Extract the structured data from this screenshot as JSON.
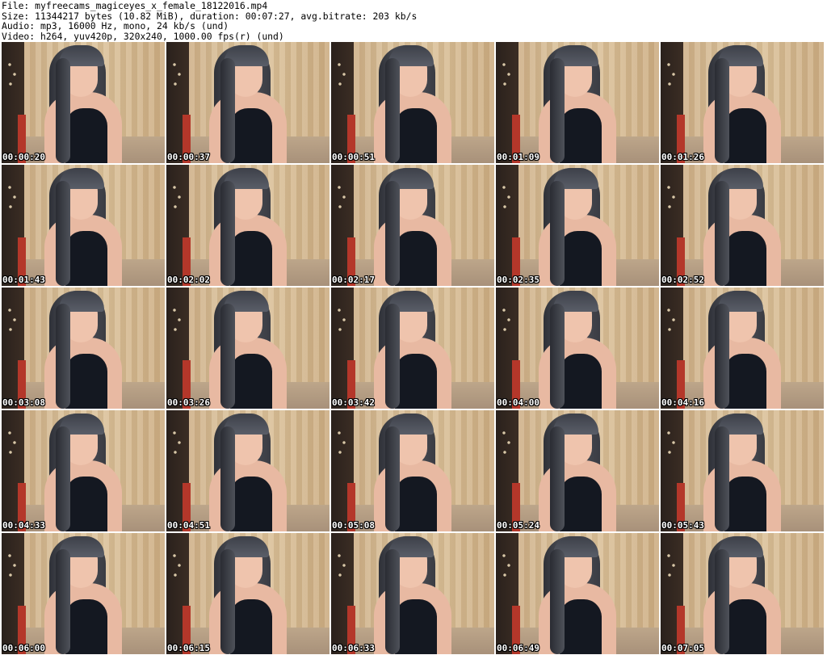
{
  "header": {
    "file_line": "File: myfreecams_magiceyes_x_female_18122016.mp4",
    "size_line": "Size: 11344217 bytes (10.82 MiB), duration: 00:07:27, avg.bitrate: 203 kb/s",
    "audio_line": "Audio: mp3, 16000 Hz, mono, 24 kb/s (und)",
    "video_line": "Video: h264, yuv420p, 320x240, 1000.00 fps(r) (und)"
  },
  "thumbnails": [
    {
      "time": "00:00:20"
    },
    {
      "time": "00:00:37"
    },
    {
      "time": "00:00:51"
    },
    {
      "time": "00:01:09"
    },
    {
      "time": "00:01:26"
    },
    {
      "time": "00:01:43"
    },
    {
      "time": "00:02:02"
    },
    {
      "time": "00:02:17"
    },
    {
      "time": "00:02:35"
    },
    {
      "time": "00:02:52"
    },
    {
      "time": "00:03:08"
    },
    {
      "time": "00:03:26"
    },
    {
      "time": "00:03:42"
    },
    {
      "time": "00:04:00"
    },
    {
      "time": "00:04:16"
    },
    {
      "time": "00:04:33"
    },
    {
      "time": "00:04:51"
    },
    {
      "time": "00:05:08"
    },
    {
      "time": "00:05:24"
    },
    {
      "time": "00:05:43"
    },
    {
      "time": "00:06:00"
    },
    {
      "time": "00:06:15"
    },
    {
      "time": "00:06:33"
    },
    {
      "time": "00:06:49"
    },
    {
      "time": "00:07:05"
    }
  ]
}
